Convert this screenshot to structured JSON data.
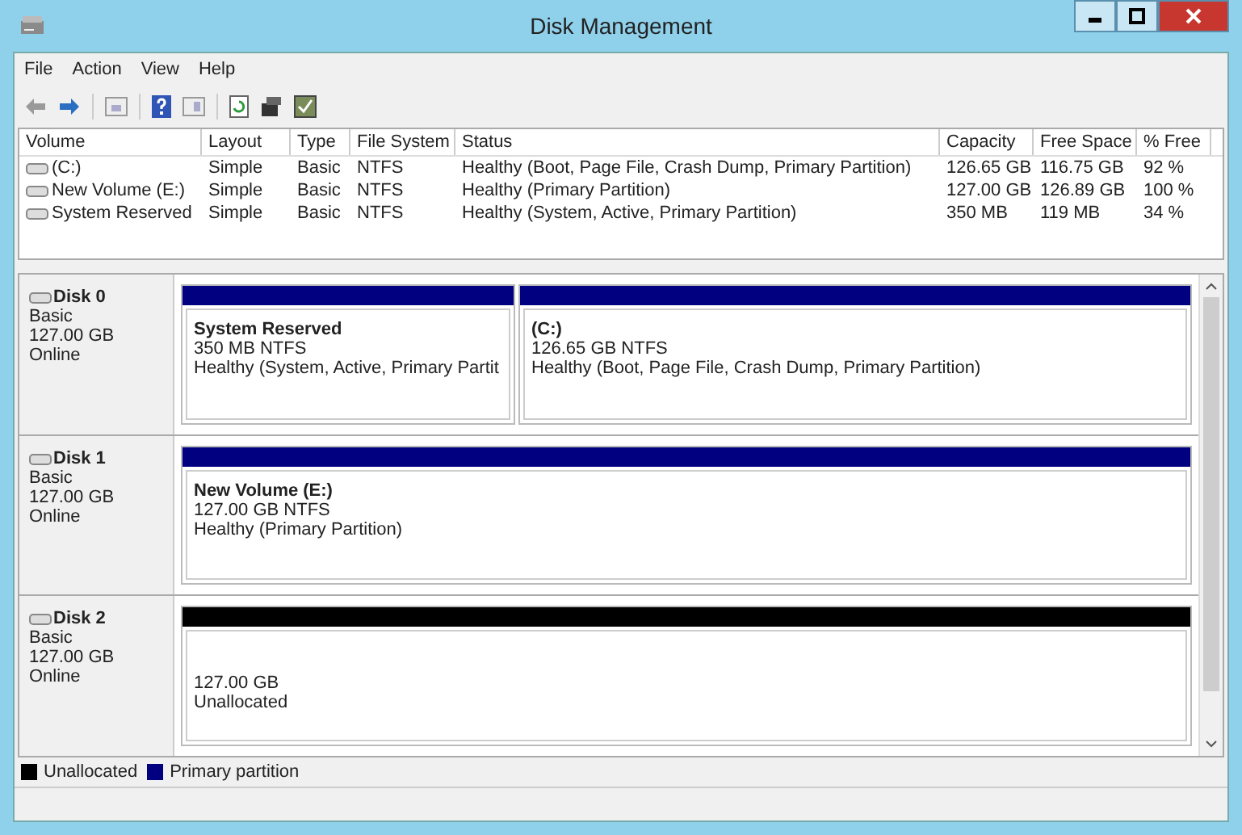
{
  "window": {
    "title": "Disk Management"
  },
  "menu": [
    "File",
    "Action",
    "View",
    "Help"
  ],
  "table": {
    "columns": [
      "Volume",
      "Layout",
      "Type",
      "File System",
      "Status",
      "Capacity",
      "Free Space",
      "% Free"
    ],
    "rows": [
      [
        "(C:)",
        "Simple",
        "Basic",
        "NTFS",
        "Healthy (Boot, Page File, Crash Dump, Primary Partition)",
        "126.65 GB",
        "116.75 GB",
        "92 %"
      ],
      [
        "New Volume (E:)",
        "Simple",
        "Basic",
        "NTFS",
        "Healthy (Primary Partition)",
        "127.00 GB",
        "126.89 GB",
        "100 %"
      ],
      [
        "System Reserved",
        "Simple",
        "Basic",
        "NTFS",
        "Healthy (System, Active, Primary Partition)",
        "350 MB",
        "119 MB",
        "34 %"
      ]
    ]
  },
  "disks": [
    {
      "name": "Disk 0",
      "type": "Basic",
      "size": "127.00 GB",
      "status": "Online",
      "partitions": [
        {
          "kind": "primary",
          "name": "System Reserved",
          "size": "350 MB NTFS",
          "status": "Healthy (System, Active, Primary Partit"
        },
        {
          "kind": "primary",
          "name": "(C:)",
          "size": "126.65 GB NTFS",
          "status": "Healthy (Boot, Page File, Crash Dump, Primary Partition)"
        }
      ]
    },
    {
      "name": "Disk 1",
      "type": "Basic",
      "size": "127.00 GB",
      "status": "Online",
      "partitions": [
        {
          "kind": "primary",
          "name": "New Volume  (E:)",
          "size": "127.00 GB NTFS",
          "status": "Healthy (Primary Partition)"
        }
      ]
    },
    {
      "name": "Disk 2",
      "type": "Basic",
      "size": "127.00 GB",
      "status": "Online",
      "partitions": [
        {
          "kind": "unallocated",
          "size": "127.00 GB",
          "status": "Unallocated"
        }
      ]
    }
  ],
  "legend": [
    {
      "label": "Unallocated",
      "color": "#000000"
    },
    {
      "label": "Primary partition",
      "color": "#000080"
    }
  ]
}
